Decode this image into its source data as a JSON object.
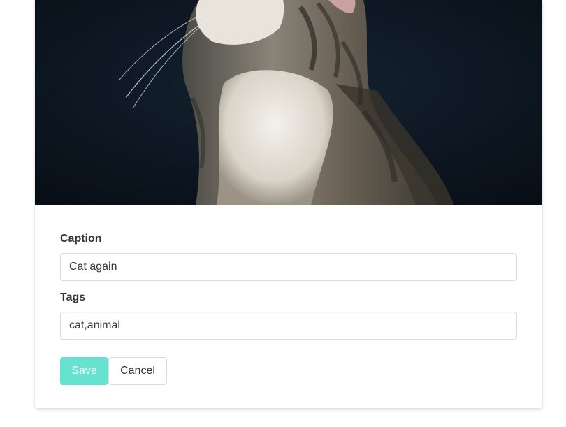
{
  "image": {
    "subject": "cat-photo",
    "background_color": "#0b1520"
  },
  "form": {
    "caption_label": "Caption",
    "caption_value": "Cat again",
    "tags_label": "Tags",
    "tags_value": "cat,animal"
  },
  "actions": {
    "save_label": "Save",
    "cancel_label": "Cancel",
    "save_color": "#00d1b2"
  }
}
